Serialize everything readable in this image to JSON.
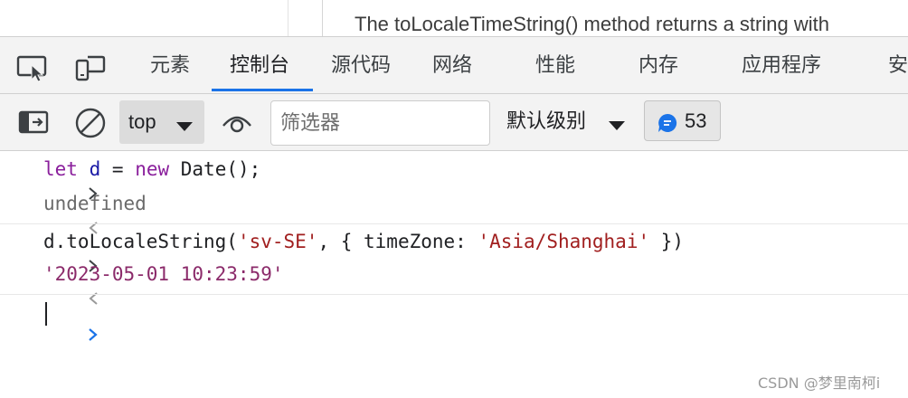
{
  "page_strip": {
    "text": "The toLocaleTimeString() method returns a string with"
  },
  "tabs": [
    {
      "label": "元素"
    },
    {
      "label": "控制台",
      "active": true
    },
    {
      "label": "源代码"
    },
    {
      "label": "网络"
    },
    {
      "label": "性能"
    },
    {
      "label": "内存"
    },
    {
      "label": "应用程序"
    },
    {
      "label": "安"
    }
  ],
  "toolbar": {
    "context": "top",
    "filter_placeholder": "筛选器",
    "level": "默认级别",
    "issues_count": "53"
  },
  "console": {
    "lines": [
      {
        "type": "input",
        "tokens": [
          {
            "t": "let",
            "c": "keyword"
          },
          {
            "t": " ",
            "c": "plain"
          },
          {
            "t": "d",
            "c": "variable"
          },
          {
            "t": " = ",
            "c": "plain"
          },
          {
            "t": "new",
            "c": "keyword"
          },
          {
            "t": " Date();",
            "c": "plain"
          }
        ]
      },
      {
        "type": "output",
        "tokens": [
          {
            "t": "undefined",
            "c": "undefined"
          }
        ]
      },
      {
        "type": "input",
        "tokens": [
          {
            "t": "d.toLocaleString(",
            "c": "plain"
          },
          {
            "t": "'sv-SE'",
            "c": "string"
          },
          {
            "t": ", { timeZone: ",
            "c": "plain"
          },
          {
            "t": "'Asia/Shanghai'",
            "c": "string"
          },
          {
            "t": " })",
            "c": "plain"
          }
        ]
      },
      {
        "type": "output",
        "tokens": [
          {
            "t": "'2023-05-01 10:23:59'",
            "c": "result-string"
          }
        ]
      }
    ]
  },
  "watermark": "CSDN @梦里南柯i",
  "colors": {
    "accent": "#1a73e8",
    "keyword": "#8a1f9c",
    "string": "#a11f1f",
    "result_string": "#8b2a6a"
  },
  "icons": [
    "device-select-icon",
    "device-toolbar-icon",
    "sidebar-toggle-icon",
    "clear-console-icon",
    "chevron-down-icon",
    "live-expression-eye-icon",
    "message-bubble-icon",
    "prompt-chevron-icon",
    "result-chevron-icon"
  ]
}
